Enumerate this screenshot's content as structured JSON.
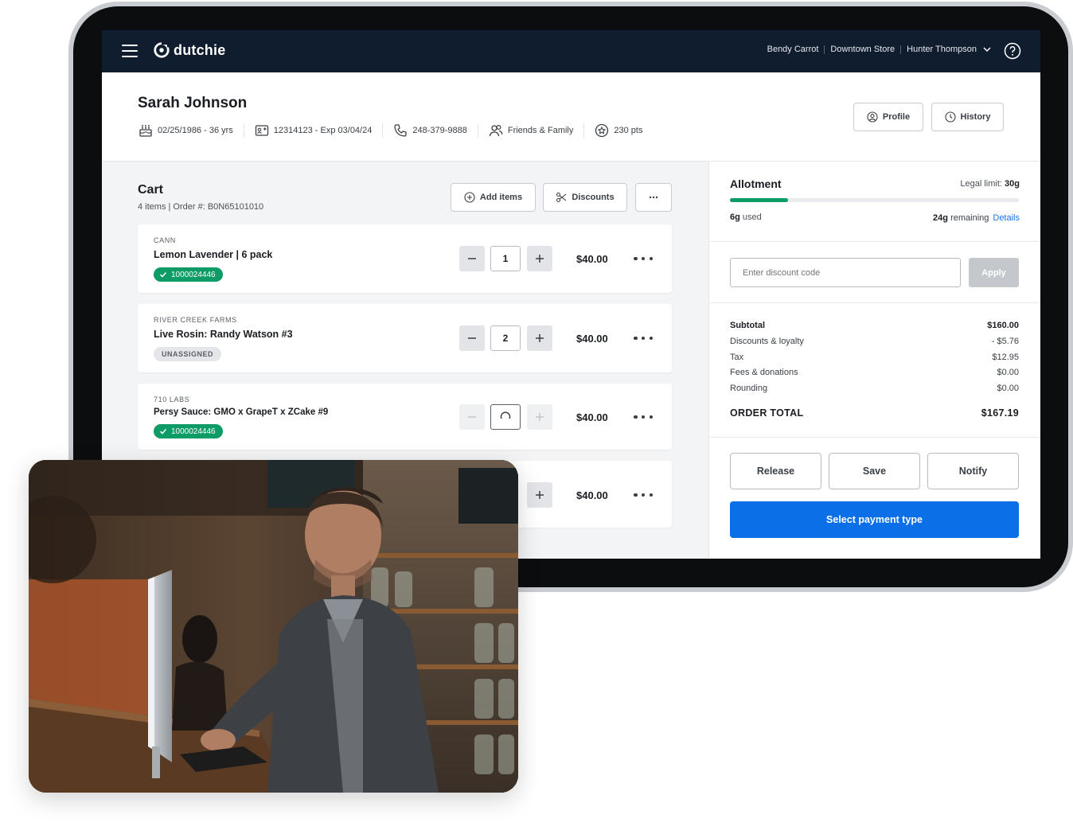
{
  "header": {
    "brand": "dutchie",
    "user_context": [
      "Bendy Carrot",
      "Downtown Store",
      "Hunter Thompson"
    ],
    "icons": [
      "menu-icon",
      "dutchie-logo-icon",
      "chevron-down-icon",
      "help-icon"
    ]
  },
  "customer": {
    "name": "Sarah Johnson",
    "dob": "02/25/1986 - 36 yrs",
    "id": "12314123 - Exp 03/04/24",
    "phone": "248-379-9888",
    "group": "Friends & Family",
    "points": "230 pts",
    "profile_label": "Profile",
    "history_label": "History"
  },
  "cart": {
    "title": "Cart",
    "subtitle": "4 items  |  Order #: B0N65101010",
    "add_items_label": "Add items",
    "discounts_label": "Discounts",
    "items": [
      {
        "brand": "CANN",
        "name": "Lemon Lavender | 6 pack",
        "tag": "1000024446",
        "tag_type": "assigned",
        "qty": "1",
        "price": "$40.00"
      },
      {
        "brand": "RIVER CREEK FARMS",
        "name": "Live Rosin: Randy Watson #3",
        "tag": "UNASSIGNED",
        "tag_type": "unassigned",
        "qty": "2",
        "price": "$40.00"
      },
      {
        "brand": "710 LABS",
        "name": "Persy Sauce: GMO x GrapeT x ZCake #9",
        "tag": "1000024446",
        "tag_type": "assigned",
        "qty": "",
        "price": "$40.00",
        "loading": true
      },
      {
        "brand": "",
        "name": "",
        "tag": "",
        "qty": "",
        "price": "$40.00"
      }
    ]
  },
  "allotment": {
    "title": "Allotment",
    "legal_prefix": "Legal limit: ",
    "legal_value": "30g",
    "used_value": "6g",
    "used_suffix": " used",
    "remaining_value": "24g",
    "remaining_suffix": " remaining",
    "details_label": "Details",
    "used_fraction": 0.2,
    "accent": "#0d9b66"
  },
  "discount": {
    "placeholder": "Enter discount code",
    "apply_label": "Apply"
  },
  "summary": {
    "subtotal_label": "Subtotal",
    "subtotal": "$160.00",
    "discounts_label": "Discounts & loyalty",
    "discounts": "- $5.76",
    "tax_label": "Tax",
    "tax": "$12.95",
    "fees_label": "Fees & donations",
    "fees": "$0.00",
    "rounding_label": "Rounding",
    "rounding": "$0.00",
    "total_label": "ORDER TOTAL",
    "total": "$167.19"
  },
  "actions": {
    "release": "Release",
    "save": "Save",
    "notify": "Notify",
    "pay": "Select payment type",
    "pay_color": "#0b6fe8"
  }
}
